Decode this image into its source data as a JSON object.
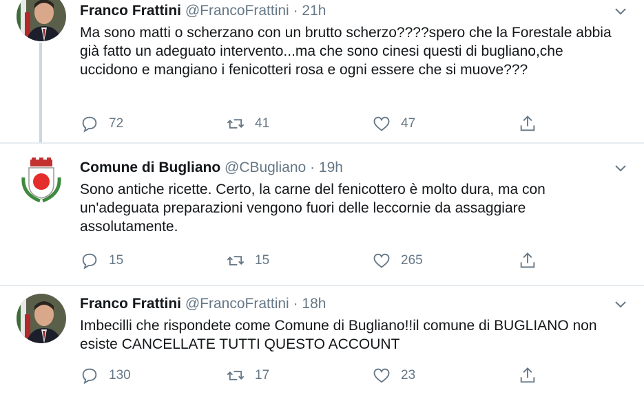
{
  "tweets": [
    {
      "name": "Franco Frattini",
      "handle": "@FrancoFrattini",
      "sep": "·",
      "time": "21h",
      "text": "Ma sono matti o scherzano con un brutto scherzo????spero che la Forestale abbia già fatto un adeguato intervento...ma che sono cinesi questi di bugliano,che uccidono e mangiano  i fenicotteri rosa e ogni essere che si muove???",
      "replies": "72",
      "retweets": "41",
      "likes": "47"
    },
    {
      "name": "Comune di Bugliano",
      "handle": "@CBugliano",
      "sep": "·",
      "time": "19h",
      "text": "Sono antiche ricette. Certo, la carne del fenicottero è molto dura, ma con un'adeguata preparazioni vengono fuori delle leccornie da assaggiare assolutamente.",
      "replies": "15",
      "retweets": "15",
      "likes": "265"
    },
    {
      "name": "Franco Frattini",
      "handle": "@FrancoFrattini",
      "sep": "·",
      "time": "18h",
      "text": "Imbecilli che rispondete come Comune di Bugliano!!il comune di BUGLIANO non esiste CANCELLATE TUTTI QUESTO ACCOUNT",
      "replies": "130",
      "retweets": "17",
      "likes": "23"
    }
  ],
  "icons": {
    "reply": "reply-icon",
    "retweet": "retweet-icon",
    "like": "like-icon",
    "share": "share-icon",
    "more": "chevron-down-icon"
  },
  "colors": {
    "text": "#14171a",
    "secondary": "#657786",
    "divider": "#e6ecf0"
  }
}
